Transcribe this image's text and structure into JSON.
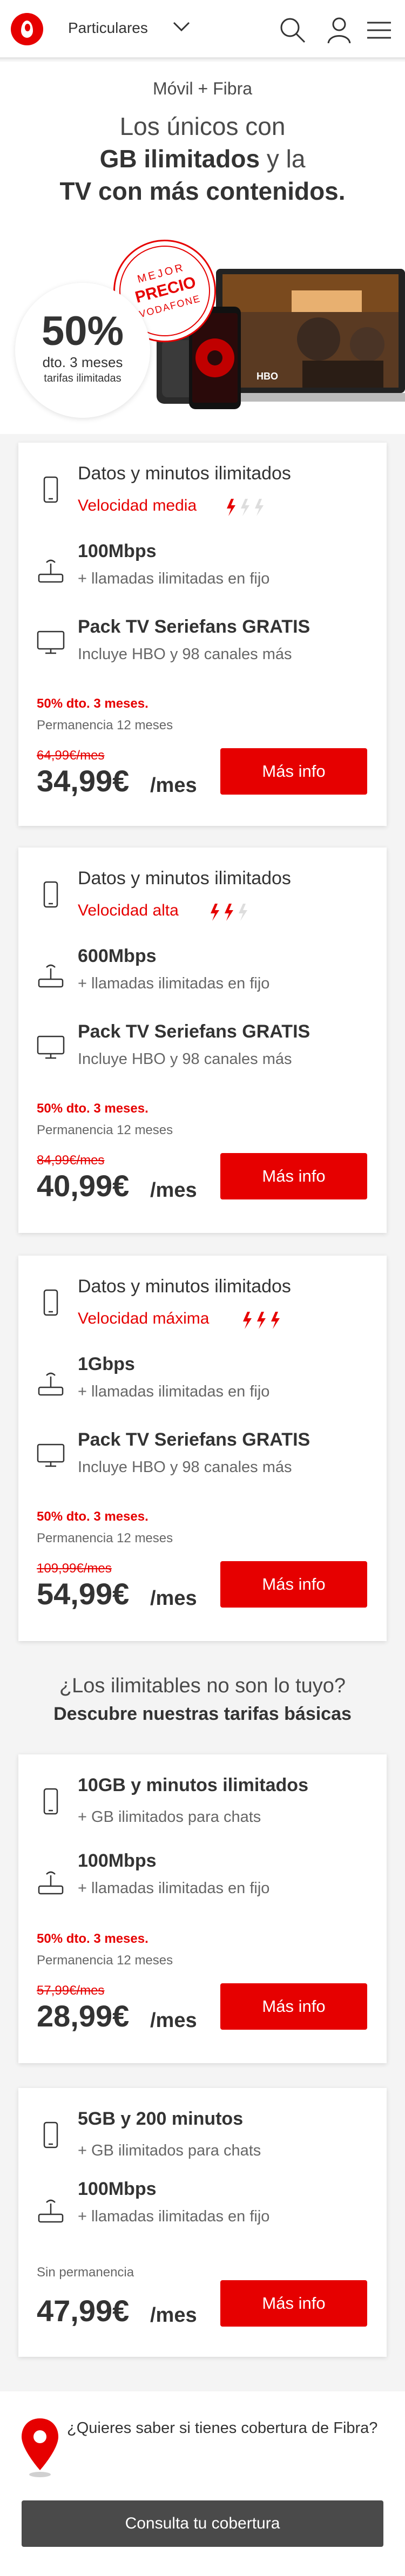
{
  "header": {
    "segment": "Particulares",
    "icons": [
      "search-icon",
      "user-icon",
      "menu-icon"
    ]
  },
  "hero": {
    "pre": "Móvil + Fibra",
    "title_part1": "Los únicos con",
    "title_bold1": "GB ilimitados",
    "title_part2": " y la",
    "title_bold2": "TV con más contenidos.",
    "discount_pct": "50%",
    "discount_dto": "dto. 3 meses",
    "discount_sub": "tarifas ilimitadas",
    "stamp_l1": "MEJOR",
    "stamp_l2": "PRECIO",
    "stamp_l3": "VODAFONE",
    "tv_badge": "HBO"
  },
  "plans": [
    {
      "title": "Datos y minutos ilimitados",
      "speed_label": "Velocidad media",
      "speed_level": 1,
      "fiber": "100Mbps",
      "fiber_sub": "+ llamadas ilimitadas en fijo",
      "tv": "Pack TV Seriefans GRATIS",
      "tv_sub": "Incluye HBO y 98 canales más",
      "promo": "50% dto. 3 meses.",
      "perm": "Permanencia 12 meses",
      "old_price": "64,99€/mes",
      "price": "34,99€",
      "per": "/mes",
      "button": "Más info"
    },
    {
      "title": "Datos y minutos ilimitados",
      "speed_label": "Velocidad alta",
      "speed_level": 2,
      "fiber": "600Mbps",
      "fiber_sub": "+ llamadas ilimitadas en fijo",
      "tv": "Pack TV Seriefans GRATIS",
      "tv_sub": "Incluye HBO y 98 canales más",
      "promo": "50% dto. 3 meses.",
      "perm": "Permanencia 12 meses",
      "old_price": "84,99€/mes",
      "price": "40,99€",
      "per": "/mes",
      "button": "Más info"
    },
    {
      "title": "Datos y minutos ilimitados",
      "speed_label": "Velocidad máxima",
      "speed_level": 3,
      "fiber": "1Gbps",
      "fiber_sub": "+ llamadas ilimitadas en fijo",
      "tv": "Pack TV Seriefans GRATIS",
      "tv_sub": "Incluye HBO y 98 canales más",
      "promo": "50% dto. 3 meses.",
      "perm": "Permanencia 12 meses",
      "old_price": "109,99€/mes",
      "price": "54,99€",
      "per": "/mes",
      "button": "Más info"
    }
  ],
  "basic": {
    "question": "¿Los ilimitables no son lo tuyo?",
    "subtitle": "Descubre nuestras tarifas básicas",
    "plans": [
      {
        "title": "10GB y minutos ilimitados",
        "title_sub": "+ GB ilimitados para chats",
        "fiber": "100Mbps",
        "fiber_sub": "+ llamadas ilimitadas en fijo",
        "promo": "50% dto. 3 meses.",
        "perm": "Permanencia 12 meses",
        "old_price": "57,99€/mes",
        "price": "28,99€",
        "per": "/mes",
        "button": "Más info"
      },
      {
        "title": "5GB y 200 minutos",
        "title_sub": "+ GB ilimitados para chats",
        "fiber": "100Mbps",
        "fiber_sub": "+ llamadas ilimitadas en fijo",
        "perm": "Sin permanencia",
        "price": "47,99€",
        "per": "/mes",
        "button": "Más info"
      }
    ]
  },
  "coverage": {
    "question": "¿Quieres saber si tienes cobertura de Fibra?",
    "button": "Consulta tu cobertura"
  },
  "colors": {
    "brand": "#e60000",
    "dark_button": "#4a4a4a"
  }
}
